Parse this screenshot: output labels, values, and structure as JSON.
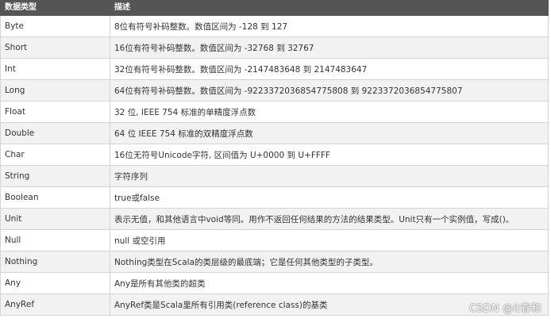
{
  "table": {
    "headers": [
      "数据类型",
      "描述"
    ],
    "rows": [
      [
        "Byte",
        "8位有符号补码整数。数值区间为 -128 到 127"
      ],
      [
        "Short",
        "16位有符号补码整数。数值区间为 -32768 到 32767"
      ],
      [
        "Int",
        "32位有符号补码整数。数值区间为 -2147483648 到 2147483647"
      ],
      [
        "Long",
        "64位有符号补码整数。数值区间为 -9223372036854775808 到 9223372036854775807"
      ],
      [
        "Float",
        "32 位, IEEE 754 标准的单精度浮点数"
      ],
      [
        "Double",
        "64 位 IEEE 754 标准的双精度浮点数"
      ],
      [
        "Char",
        "16位无符号Unicode字符, 区间值为 U+0000 到 U+FFFF"
      ],
      [
        "String",
        "字符序列"
      ],
      [
        "Boolean",
        "true或false"
      ],
      [
        "Unit",
        "表示无值，和其他语言中void等同。用作不返回任何结果的方法的结果类型。Unit只有一个实例值，写成()。"
      ],
      [
        "Null",
        "null 或空引用"
      ],
      [
        "Nothing",
        "Nothing类型在Scala的类层级的最底端；它是任何其他类型的子类型。"
      ],
      [
        "Any",
        "Any是所有其他类的超类"
      ],
      [
        "AnyRef",
        "AnyRef类是Scala里所有引用类(reference class)的基类"
      ]
    ]
  },
  "watermark": "CSDN @it春和",
  "colors": {
    "header_bg": "#555555",
    "header_text": "#ffffff",
    "row_alt_bg": "#f2f2f2",
    "border": "#d4d4d4",
    "text": "#333333"
  }
}
